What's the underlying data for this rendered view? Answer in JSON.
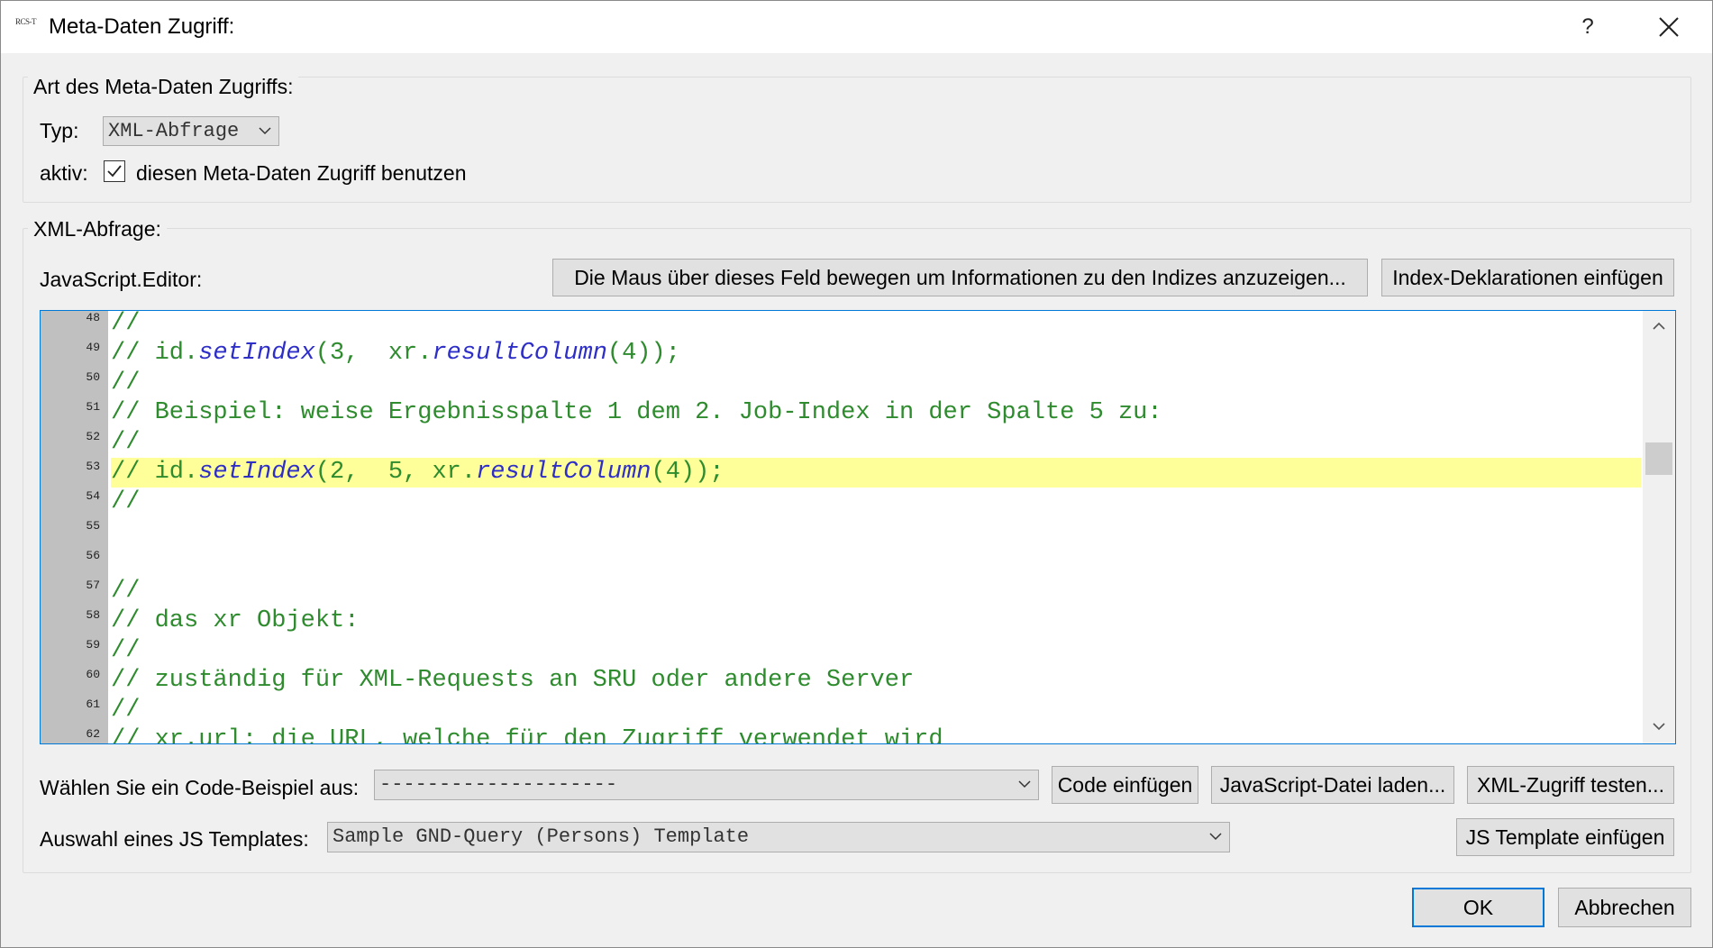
{
  "window": {
    "app_icon_text": "RCS-T",
    "title": "Meta-Daten Zugriff:",
    "help_label": "?"
  },
  "access_group": {
    "label": "Art des Meta-Daten Zugriffs:",
    "type_label": "Typ:",
    "type_value": "XML-Abfrage",
    "active_label": "aktiv:",
    "active_checked": true,
    "active_checkbox_label": "diesen Meta-Daten Zugriff benutzen"
  },
  "xml_group": {
    "label": "XML-Abfrage:",
    "editor_label": "JavaScript.Editor:",
    "info_button": "Die Maus über dieses Feld bewegen um Informationen zu den Indizes anzuzeigen...",
    "insert_index_button": "Index-Deklarationen einfügen"
  },
  "editor": {
    "current_line": 53,
    "lines": [
      {
        "num": "48",
        "code": "//"
      },
      {
        "num": "49",
        "code": "// id.<i>setIndex</i>(3,  xr.<i>resultColumn</i>(4));"
      },
      {
        "num": "50",
        "code": "//"
      },
      {
        "num": "51",
        "code": "// Beispiel: weise Ergebnisspalte 1 dem 2. Job-Index in der Spalte 5 zu:"
      },
      {
        "num": "52",
        "code": "//"
      },
      {
        "num": "53",
        "code": "// id.<i>setIndex</i>(2,  5, xr.<i>resultColumn</i>(4));"
      },
      {
        "num": "54",
        "code": "//"
      },
      {
        "num": "55",
        "code": ""
      },
      {
        "num": "56",
        "code": ""
      },
      {
        "num": "57",
        "code": "//"
      },
      {
        "num": "58",
        "code": "// das xr Objekt:"
      },
      {
        "num": "59",
        "code": "//"
      },
      {
        "num": "60",
        "code": "// zuständig für XML-Requests an SRU oder andere Server"
      },
      {
        "num": "61",
        "code": "//"
      },
      {
        "num": "62",
        "code": "// xr.url: die URL, welche für den Zugriff verwendet wird"
      }
    ]
  },
  "bottom": {
    "code_example_label": "Wählen Sie ein Code-Beispiel aus:",
    "code_example_value": "--------------------",
    "insert_code_button": "Code einfügen",
    "load_js_button": "JavaScript-Datei laden...",
    "test_xml_button": "XML-Zugriff testen...",
    "template_label": "Auswahl eines JS Templates:",
    "template_value": "Sample GND-Query (Persons) Template",
    "insert_template_button": "JS Template einfügen"
  },
  "dialog_buttons": {
    "ok": "OK",
    "cancel": "Abbrechen"
  }
}
